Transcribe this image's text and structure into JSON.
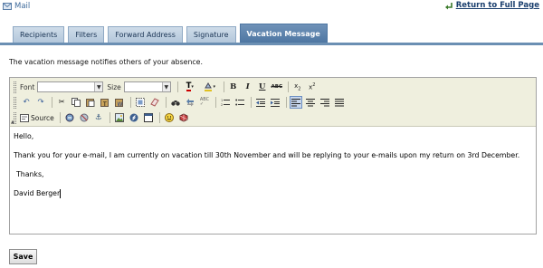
{
  "header": {
    "title": "Mail",
    "return_link": "Return to Full Page"
  },
  "tabs": [
    {
      "label": "Recipients",
      "active": false
    },
    {
      "label": "Filters",
      "active": false
    },
    {
      "label": "Forward Address",
      "active": false
    },
    {
      "label": "Signature",
      "active": false
    },
    {
      "label": "Vacation Message",
      "active": true
    }
  ],
  "description": "The vacation message notifies others of your absence.",
  "toolbar": {
    "font_label": "Font",
    "font_value": "",
    "size_label": "Size",
    "size_value": "",
    "source_label": "Source"
  },
  "message": {
    "greeting": "Hello,",
    "body": "Thank you for your e-mail, I am currently on vacation till 30th November and will be replying to your e-mails upon my return on 3rd December.",
    "closing": "Thanks,",
    "name": "David Berger"
  },
  "actions": {
    "save_label": "Save"
  },
  "colors": {
    "tab_active": "#4e76a2",
    "tab_inactive": "#cfdce9",
    "toolbar_bg": "#efefde",
    "link": "#1a3f6e"
  }
}
